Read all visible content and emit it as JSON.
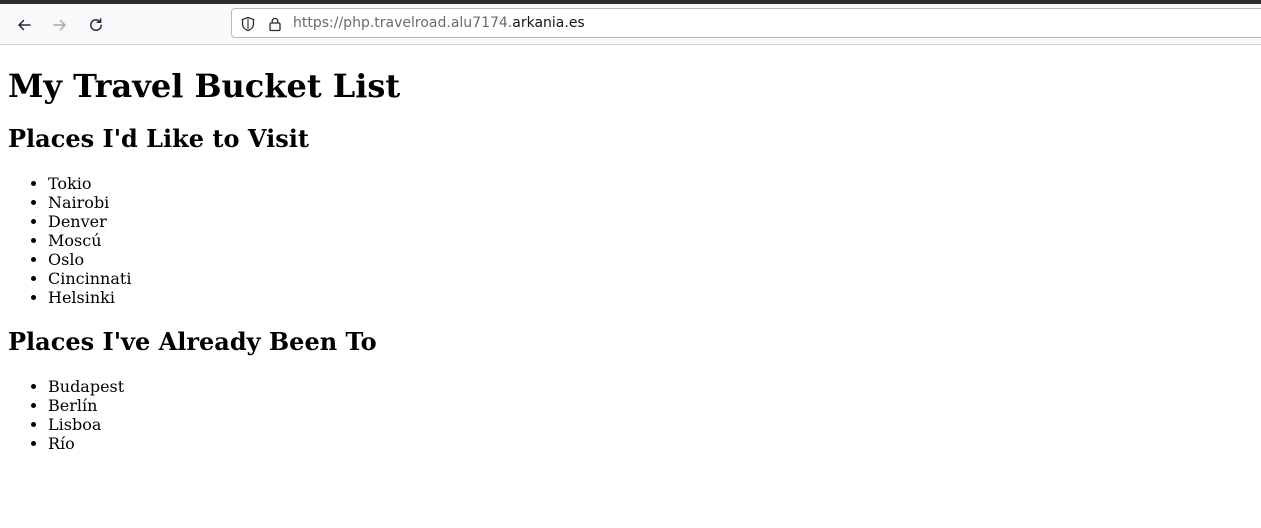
{
  "browser": {
    "url_prefix": "https://php.travelroad.alu7174.",
    "url_host": "arkania.es",
    "icons": {
      "back": "arrow-left-icon",
      "forward": "arrow-right-icon",
      "reload": "reload-icon",
      "shield": "shield-icon",
      "lock": "lock-icon"
    }
  },
  "page": {
    "title": "My Travel Bucket List",
    "sections": [
      {
        "heading": "Places I'd Like to Visit",
        "items": [
          "Tokio",
          "Nairobi",
          "Denver",
          "Moscú",
          "Oslo",
          "Cincinnati",
          "Helsinki"
        ]
      },
      {
        "heading": "Places I've Already Been To",
        "items": [
          "Budapest",
          "Berlín",
          "Lisboa",
          "Río"
        ]
      }
    ]
  }
}
